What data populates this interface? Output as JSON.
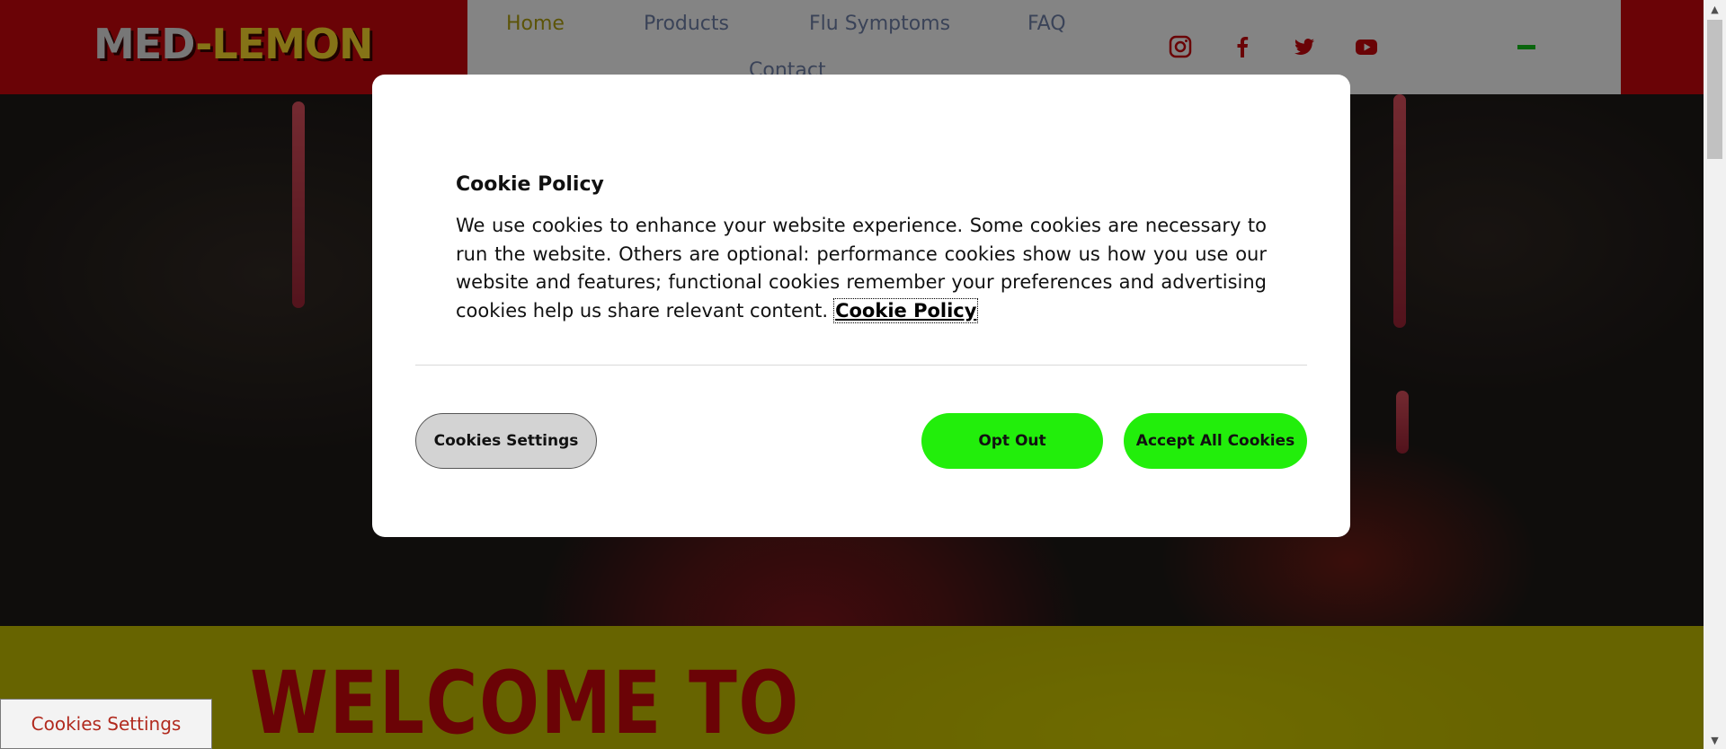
{
  "header": {
    "logo_part1": "MED",
    "logo_dash": "-",
    "logo_part2": "LEMON",
    "nav": [
      {
        "label": "Home"
      },
      {
        "label": "Products"
      },
      {
        "label": "Flu Symptoms"
      },
      {
        "label": "FAQ"
      },
      {
        "label": "Contact"
      }
    ],
    "social_icons": [
      "instagram-icon",
      "facebook-icon",
      "twitter-icon",
      "youtube-icon"
    ],
    "menu_icon": "hamburger-menu-icon"
  },
  "hero": {
    "welcome_text": "WELCOME TO"
  },
  "cookie_modal": {
    "title": "Cookie Policy",
    "body": "We use cookies to enhance your website experience. Some cookies are necessary to run the website. Others are optional: performance cookies show us how you use our website and features; functional cookies remember your preferences and advertising cookies help us share relevant content.",
    "policy_link": "Cookie Policy",
    "buttons": {
      "settings": "Cookies Settings",
      "opt_out": "Opt Out",
      "accept_all": "Accept All Cookies"
    }
  },
  "floating_cookie_settings": "Cookies Settings",
  "colors": {
    "brand_red": "#c1070b",
    "brand_yellow": "#bcb600",
    "accept_green": "#22ee0b",
    "nav_active": "#a89a10"
  }
}
